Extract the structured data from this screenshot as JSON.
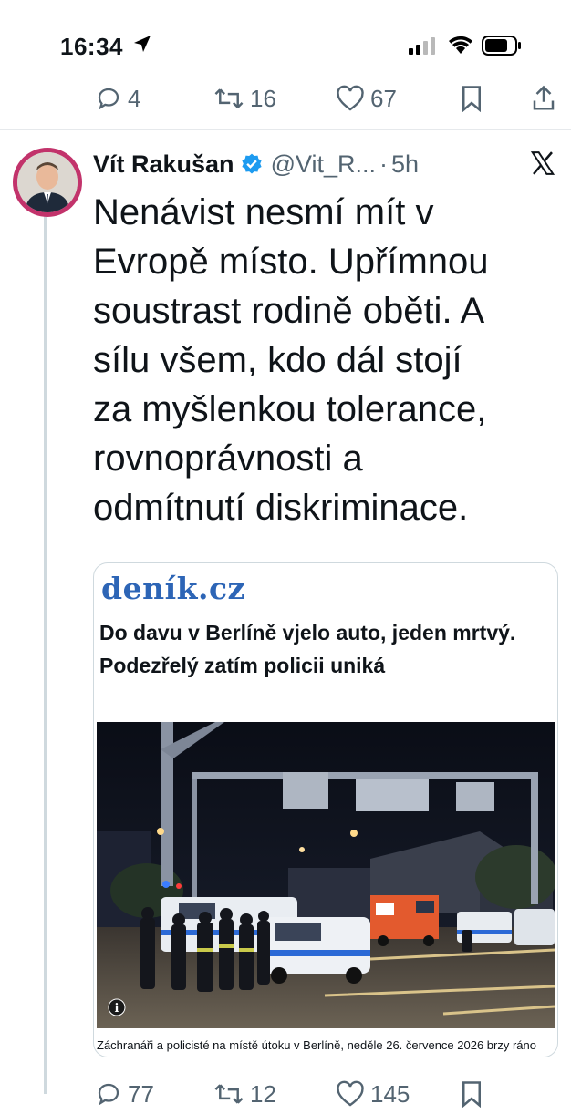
{
  "status_bar": {
    "time": "16:34"
  },
  "previous_tweet_actions": {
    "replies": "4",
    "reposts": "16",
    "likes": "67"
  },
  "tweet": {
    "author_name": "Vít Rakušan",
    "handle": "@Vit_R...",
    "separator": "·",
    "time": "5h",
    "text": "Nenávist nesmí mít v\nEvropě místo. Upřímnou\nsoustrast rodině oběti. A\nsílu všem, kdo dál stojí\nza myšlenkou tolerance,\nrovnoprávnosti a\nodmítnutí diskriminace."
  },
  "link_card": {
    "site_logo": "deník.cz",
    "headline": "Do davu v Berlíně vjelo auto, jeden mrtvý. Podezřelý zatím policii uniká",
    "image_caption": "Záchranáři a policisté na místě útoku v Berlíně, neděle 26. července 2026 brzy ráno",
    "info_badge": "i"
  },
  "tweet_actions": {
    "replies": "77",
    "reposts": "12",
    "likes": "145"
  },
  "colors": {
    "accent": "#1d9bf0",
    "avatar_ring": "#c2336b",
    "site_logo": "#2d65b6",
    "muted": "#536471"
  }
}
